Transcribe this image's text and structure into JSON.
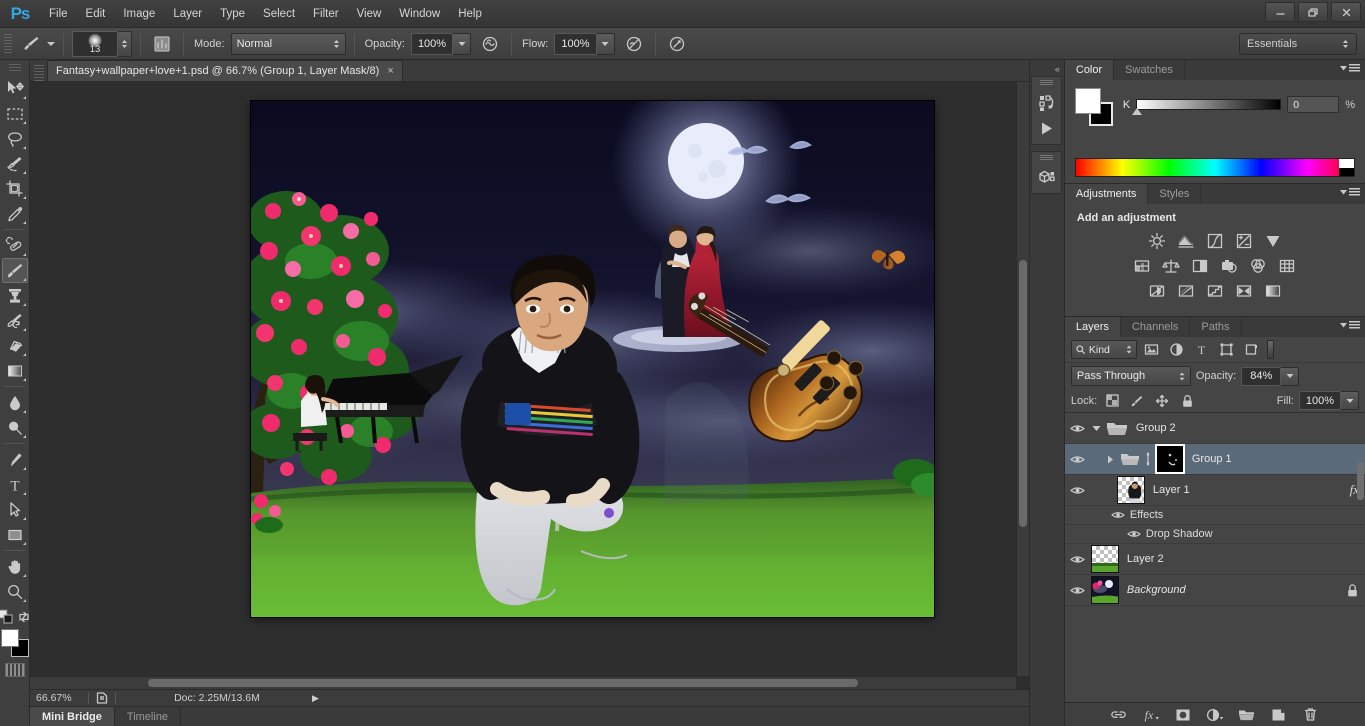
{
  "app": {
    "name": "Adobe Photoshop",
    "logo_text": "Ps"
  },
  "menubar": {
    "items": [
      "File",
      "Edit",
      "Image",
      "Layer",
      "Type",
      "Select",
      "Filter",
      "View",
      "Window",
      "Help"
    ],
    "window_controls": {
      "minimize": "–",
      "restore": "❐",
      "close": "✕"
    }
  },
  "options_bar": {
    "tool": "brush-tool",
    "brush_size": "13",
    "mode_label": "Mode:",
    "mode_value": "Normal",
    "opacity_label": "Opacity:",
    "opacity_value": "100%",
    "flow_label": "Flow:",
    "flow_value": "100%",
    "airbrush": "airbrush-toggle",
    "tablet_pressure_size": "tablet-pressure-size",
    "tablet_pressure_opacity": "tablet-pressure-opacity",
    "workspace": "Essentials"
  },
  "toolbar": {
    "tools": [
      {
        "name": "move-tool",
        "active": false
      },
      {
        "name": "rectangular-marquee-tool",
        "active": false
      },
      {
        "name": "lasso-tool",
        "active": false
      },
      {
        "name": "quick-selection-tool",
        "active": false
      },
      {
        "name": "crop-tool",
        "active": false
      },
      {
        "name": "eyedropper-tool",
        "active": false
      },
      {
        "name": "spot-healing-brush-tool",
        "active": false
      },
      {
        "name": "brush-tool",
        "active": true
      },
      {
        "name": "clone-stamp-tool",
        "active": false
      },
      {
        "name": "history-brush-tool",
        "active": false
      },
      {
        "name": "eraser-tool",
        "active": false
      },
      {
        "name": "gradient-tool",
        "active": false
      },
      {
        "name": "blur-tool",
        "active": false
      },
      {
        "name": "dodge-tool",
        "active": false
      },
      {
        "name": "pen-tool",
        "active": false
      },
      {
        "name": "horizontal-type-tool",
        "active": false
      },
      {
        "name": "path-selection-tool",
        "active": false
      },
      {
        "name": "rectangle-tool",
        "active": false
      },
      {
        "name": "hand-tool",
        "active": false
      },
      {
        "name": "zoom-tool",
        "active": false
      }
    ],
    "foreground_color": "#ffffff",
    "background_color": "#000000"
  },
  "document": {
    "tab_title": "Fantasy+wallpaper+love+1.psd @ 66.7% (Group 1, Layer Mask/8)",
    "close_glyph": "×",
    "artwork_description": "Fantasy composite: night sky with moon, dancing couple, pink flowering tree, boy crouching on grass, grand piano, electric guitar"
  },
  "status_bar": {
    "zoom": "66.67%",
    "doc_info": "Doc: 2.25M/13.6M",
    "arrow_glyph": "▶"
  },
  "bottom_dock": {
    "tabs": [
      {
        "label": "Mini Bridge",
        "selected": true
      },
      {
        "label": "Timeline",
        "selected": false
      }
    ]
  },
  "color_panel": {
    "tabs": [
      {
        "label": "Color",
        "selected": true
      },
      {
        "label": "Swatches",
        "selected": false
      }
    ],
    "channel_label": "K",
    "channel_value": "0",
    "percent_sign": "%"
  },
  "adjustments_panel": {
    "tabs": [
      {
        "label": "Adjustments",
        "selected": true
      },
      {
        "label": "Styles",
        "selected": false
      }
    ],
    "heading": "Add an adjustment",
    "icons_row1": [
      "brightness-contrast-icon",
      "levels-icon",
      "curves-icon",
      "exposure-icon",
      "vibrance-icon"
    ],
    "icons_row2": [
      "hue-saturation-icon",
      "color-balance-icon",
      "black-white-icon",
      "photo-filter-icon",
      "channel-mixer-icon",
      "color-lookup-icon"
    ],
    "icons_row3": [
      "invert-icon",
      "posterize-icon",
      "threshold-icon",
      "gradient-map-icon",
      "selective-color-icon"
    ]
  },
  "layers_panel": {
    "tabs": [
      {
        "label": "Layers",
        "selected": true
      },
      {
        "label": "Channels",
        "selected": false
      },
      {
        "label": "Paths",
        "selected": false
      }
    ],
    "filter_label": "Kind",
    "filter_icons": [
      "filter-pixel-icon",
      "filter-adjustment-icon",
      "filter-type-icon",
      "filter-shape-icon",
      "filter-smart-object-icon"
    ],
    "blend_mode": "Pass Through",
    "opacity_label": "Opacity:",
    "opacity_value": "84%",
    "lock_label": "Lock:",
    "lock_icons": [
      "lock-transparent-pixels-icon",
      "lock-image-pixels-icon",
      "lock-position-icon",
      "lock-all-icon"
    ],
    "fill_label": "Fill:",
    "fill_value": "100%",
    "rows": [
      {
        "name": "Group 2",
        "type": "group",
        "visible": true,
        "selected": false,
        "expanded": true,
        "indent": 0,
        "italic": false,
        "locked": false,
        "has_mask": false,
        "has_fx": false
      },
      {
        "name": "Group 1",
        "type": "group",
        "visible": true,
        "selected": true,
        "expanded": false,
        "indent": 1,
        "italic": false,
        "locked": false,
        "has_mask": true,
        "mask_selected": true,
        "has_fx": false
      },
      {
        "name": "Layer 1",
        "type": "layer",
        "visible": true,
        "selected": false,
        "indent": 1,
        "italic": false,
        "locked": false,
        "has_mask": false,
        "has_fx": true,
        "fx_glyph": "fx"
      },
      {
        "name": "Effects",
        "type": "effects-group",
        "visible": true,
        "indent": 2
      },
      {
        "name": "Drop Shadow",
        "type": "effect",
        "visible": true,
        "indent": 3
      },
      {
        "name": "Layer 2",
        "type": "layer",
        "visible": true,
        "selected": false,
        "indent": 0,
        "italic": false,
        "locked": false,
        "has_mask": false,
        "has_fx": false
      },
      {
        "name": "Background",
        "type": "layer",
        "visible": true,
        "selected": false,
        "indent": 0,
        "italic": true,
        "locked": true,
        "has_mask": false,
        "has_fx": false
      }
    ],
    "footer_icons": [
      "link-layers-icon",
      "add-layer-style-icon",
      "add-layer-mask-icon",
      "new-adjustment-layer-icon",
      "new-group-icon",
      "new-layer-icon",
      "delete-layer-icon"
    ]
  },
  "icon_dock": {
    "collapse_glyph": "«",
    "buttons": [
      "history-icon",
      "actions-play-icon",
      "3d-icon"
    ]
  },
  "colors": {
    "app_bg": "#3f3f3f",
    "panel_bg": "#454545",
    "canvas_bg": "#2e2e2e",
    "accent_selection": "#5b6a78",
    "logo_blue": "#33a8e0"
  }
}
